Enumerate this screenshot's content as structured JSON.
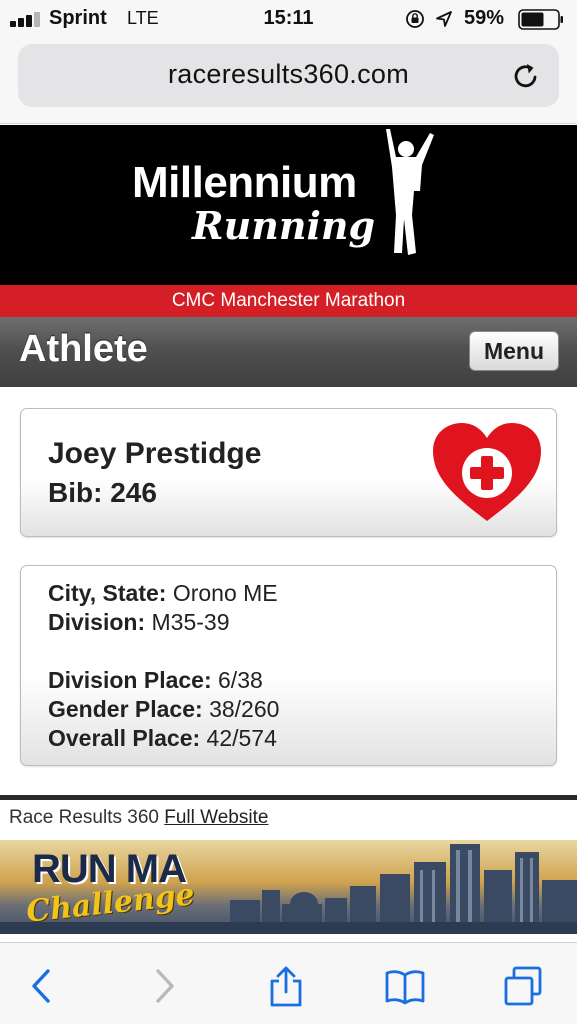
{
  "status_bar": {
    "carrier": "Sprint",
    "network": "LTE",
    "time": "15:11",
    "battery": "59%",
    "icons": [
      "signal-icon",
      "orientation-lock-icon",
      "location-icon",
      "battery-icon"
    ]
  },
  "browser": {
    "url": "raceresults360.com",
    "reload_icon": "reload-icon"
  },
  "banner": {
    "brand_line1": "Millennium",
    "brand_line2": "Running",
    "logo_icon": "runner-icon",
    "event_name": "CMC Manchester Marathon"
  },
  "header": {
    "title": "Athlete",
    "menu_label": "Menu"
  },
  "athlete": {
    "name": "Joey Prestidge",
    "bib_label": "Bib:",
    "bib": "246",
    "badge_icon": "heart-plus-icon"
  },
  "details": {
    "city_label": "City, State:",
    "city": "Orono ME",
    "division_label": "Division:",
    "division": "M35-39",
    "division_place_label": "Division Place:",
    "division_place": "6/38",
    "gender_place_label": "Gender Place:",
    "gender_place": "38/260",
    "overall_place_label": "Overall Place:",
    "overall_place": "42/574"
  },
  "footer": {
    "site_name": "Race Results 360",
    "full_site_link": "Full Website"
  },
  "ad": {
    "title": "RUN MA",
    "script": "Challenge"
  },
  "toolbar": {
    "icons": [
      "back-icon",
      "forward-icon",
      "share-icon",
      "bookmarks-icon",
      "tabs-icon"
    ]
  },
  "colors": {
    "accent_red": "#d41f26",
    "ios_blue": "#1a6fe0",
    "banner_black": "#000000"
  }
}
